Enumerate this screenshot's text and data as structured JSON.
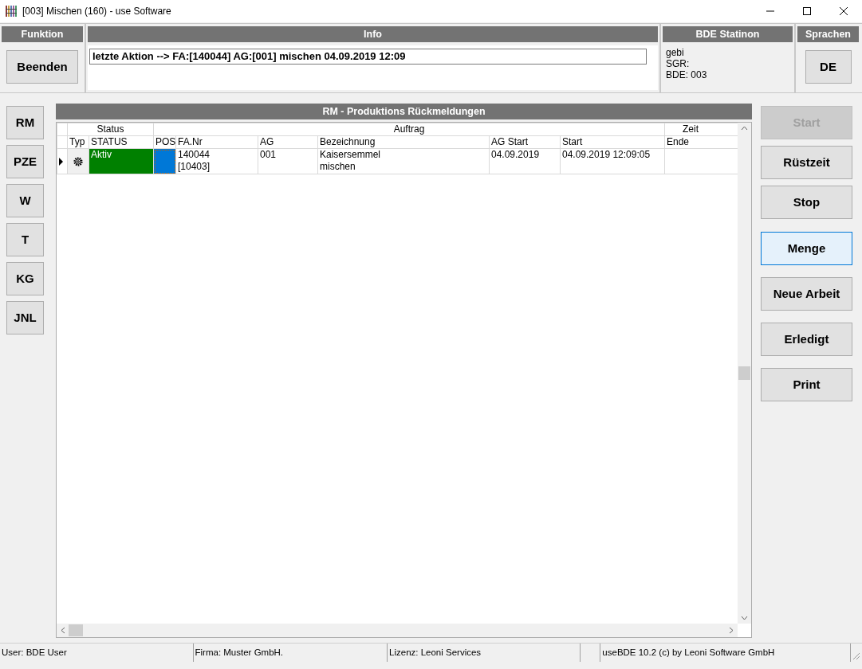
{
  "window": {
    "title": "[003] Mischen (160) - use Software"
  },
  "funktion": {
    "header": "Funktion",
    "button": "Beenden"
  },
  "info": {
    "header": "Info",
    "value": "letzte Aktion --> FA:[140044] AG:[001] mischen 04.09.2019 12:09"
  },
  "station": {
    "header": "BDE Statinon",
    "lines": [
      "gebi",
      "SGR:",
      "BDE: 003"
    ]
  },
  "sprachen": {
    "header": "Sprachen",
    "button": "DE"
  },
  "nav_buttons": [
    "RM",
    "PZE",
    "W",
    "T",
    "KG",
    "JNL"
  ],
  "panel": {
    "title": "RM - Produktions Rückmeldungen"
  },
  "table": {
    "groups": [
      "Status",
      "Auftrag",
      "Zeit"
    ],
    "columns": [
      "Typ",
      "STATUS",
      "POS",
      "FA.Nr",
      "AG",
      "Bezeichnung",
      "AG Start",
      "Start",
      "Ende"
    ],
    "rows": [
      {
        "selected": true,
        "status": "Aktiv",
        "color": "#008000",
        "fa_nr": [
          "140044",
          "[10403]"
        ],
        "ag": "001",
        "bezeichnung": [
          "Kaisersemmel",
          "mischen"
        ],
        "ag_start": "04.09.2019",
        "start": "04.09.2019 12:09:05"
      }
    ]
  },
  "action_buttons": [
    {
      "label": "Start",
      "disabled": true,
      "selected": false
    },
    {
      "label": "Rüstzeit",
      "disabled": false,
      "selected": false
    },
    {
      "label": "Stop",
      "disabled": false,
      "selected": false
    },
    {
      "label": "Menge",
      "disabled": false,
      "selected": true
    },
    {
      "label": "Neue Arbeit",
      "disabled": false,
      "selected": false
    },
    {
      "label": "Erledigt",
      "disabled": false,
      "selected": false
    },
    {
      "label": "Print",
      "disabled": false,
      "selected": false
    }
  ],
  "status_bar": [
    "User: BDE User",
    "Firma: Muster GmbH.",
    "Lizenz: Leoni Services",
    "useBDE 10.2 (c) by Leoni Software GmbH"
  ]
}
